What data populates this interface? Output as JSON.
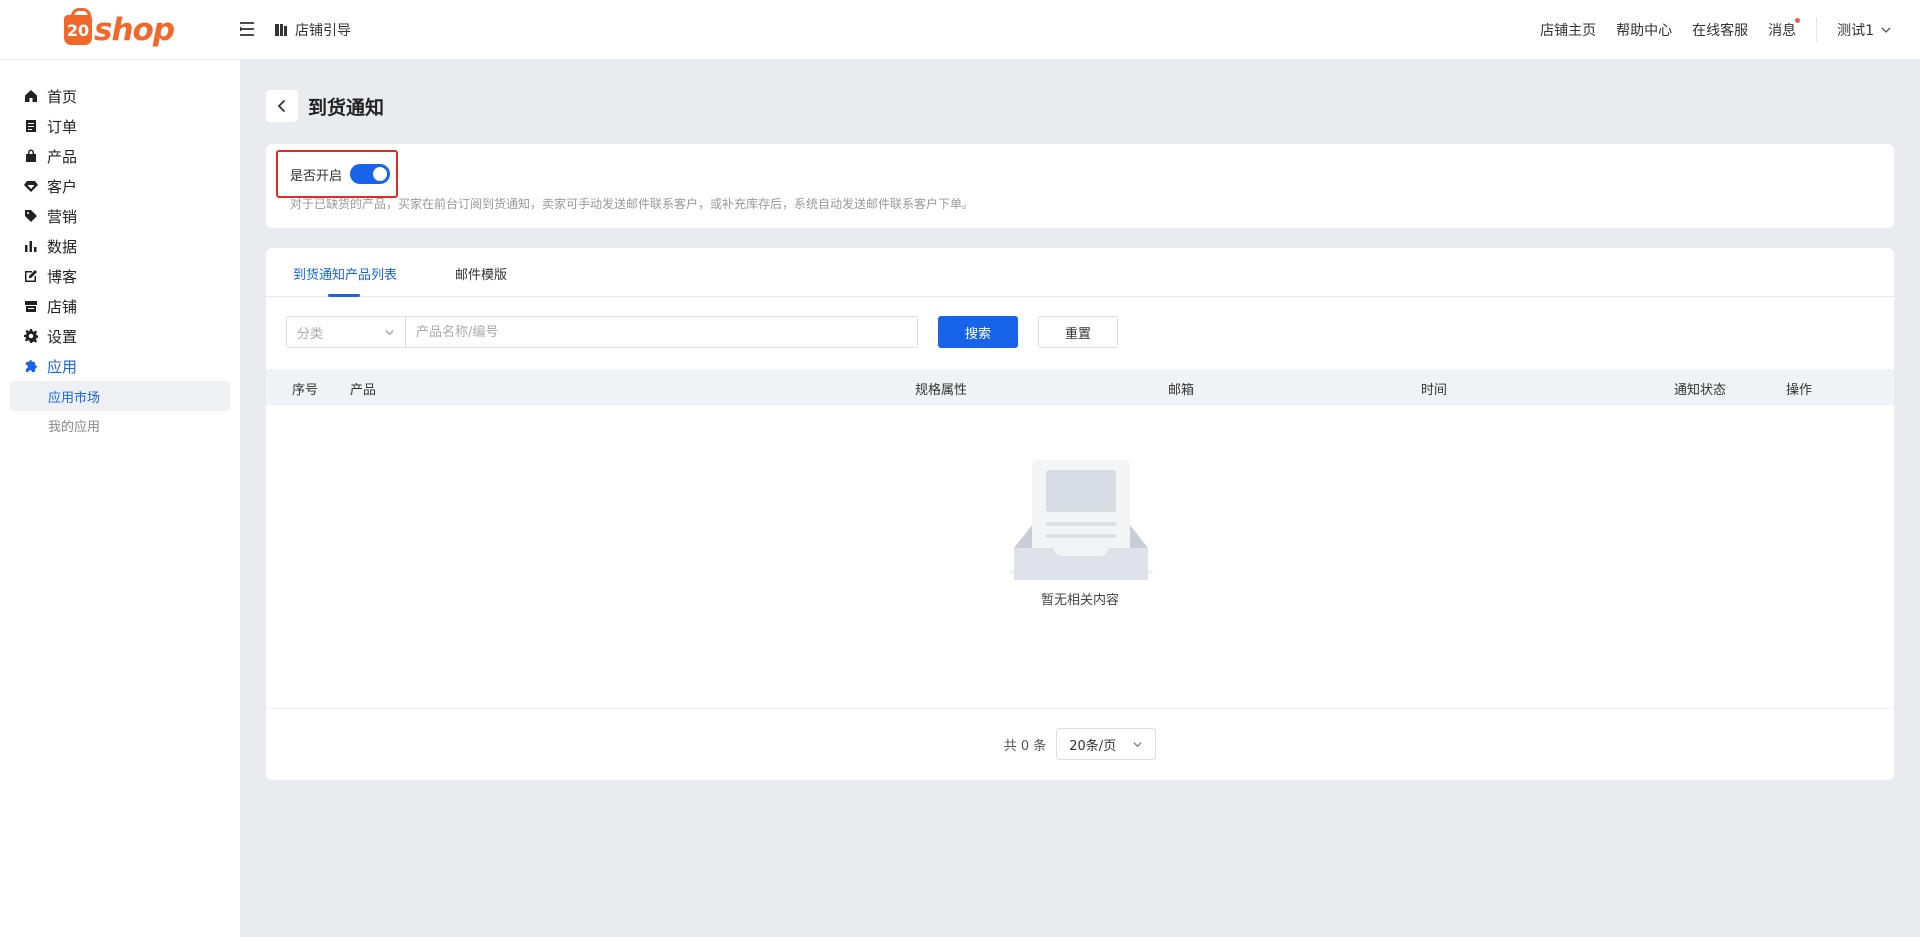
{
  "header": {
    "logo_mark": "20",
    "logo_text": "shop",
    "guide_label": "店铺引导",
    "links": [
      "店铺主页",
      "帮助中心",
      "在线客服",
      "消息"
    ],
    "user_name": "测试1"
  },
  "sidebar": {
    "items": [
      {
        "label": "首页",
        "icon": "home-icon"
      },
      {
        "label": "订单",
        "icon": "order-icon"
      },
      {
        "label": "产品",
        "icon": "bag-icon"
      },
      {
        "label": "客户",
        "icon": "diamond-icon"
      },
      {
        "label": "营销",
        "icon": "tag-icon"
      },
      {
        "label": "数据",
        "icon": "bar-chart-icon"
      },
      {
        "label": "博客",
        "icon": "edit-icon"
      },
      {
        "label": "店铺",
        "icon": "store-icon"
      },
      {
        "label": "设置",
        "icon": "gear-icon"
      },
      {
        "label": "应用",
        "icon": "puzzle-icon"
      }
    ],
    "active_item": "应用",
    "sub_items": [
      "应用市场",
      "我的应用"
    ],
    "active_sub_item": "应用市场"
  },
  "page": {
    "title": "到货通知",
    "switch_label": "是否开启",
    "switch_on": true,
    "description": "对于已缺货的产品，买家在前台订阅到货通知，卖家可手动发送邮件联系客户，或补充库存后，系统自动发送邮件联系客户下单。"
  },
  "tabs": [
    "到货通知产品列表",
    "邮件模版"
  ],
  "active_tab": "到货通知产品列表",
  "filter": {
    "category_placeholder": "分类",
    "search_placeholder": "产品名称/编号",
    "search_button": "搜索",
    "reset_button": "重置"
  },
  "table": {
    "columns": [
      "序号",
      "产品",
      "规格属性",
      "邮箱",
      "时间",
      "通知状态",
      "操作"
    ],
    "rows": [],
    "empty_text": "暂无相关内容"
  },
  "pagination": {
    "total_text": "共 0 条",
    "page_size": "20条/页"
  },
  "colors": {
    "accent": "#1764eb",
    "brand": "#f2672a",
    "highlight_border": "#e02a2a"
  }
}
